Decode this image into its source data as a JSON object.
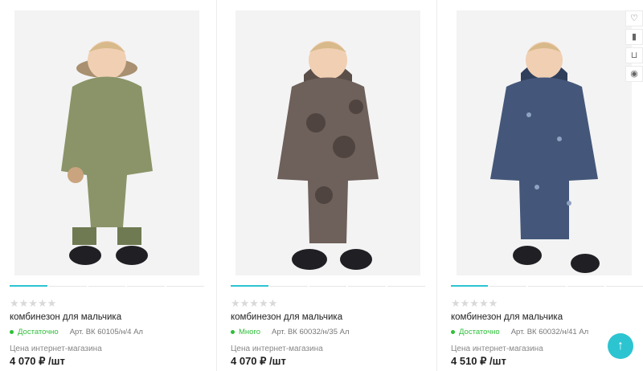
{
  "accent_color": "#2cc4d0",
  "stock_color": "#2fbf3a",
  "products": [
    {
      "stars": "★★★★★",
      "title": "комбинезон для мальчика",
      "stock": "Достаточно",
      "article": "Арт. ВК 60105/н/4 Ал",
      "price_label": "Цена интернет-магазина",
      "price": "4 070 ₽ /шт",
      "colors": [
        "#8a9468",
        "#6f7a52"
      ]
    },
    {
      "stars": "★★★★★",
      "title": "комбинезон для мальчика",
      "stock": "Много",
      "article": "Арт. ВК 60032/н/35 Ал",
      "price_label": "Цена интернет-магазина",
      "price": "4 070 ₽ /шт",
      "colors": [
        "#6e605a",
        "#4f443f"
      ]
    },
    {
      "stars": "★★★★★",
      "title": "комбинезон для мальчика",
      "stock": "Достаточно",
      "article": "Арт. ВК 60032/н/41 Ал",
      "price_label": "Цена интернет-магазина",
      "price": "4 510 ₽ /шт",
      "colors": [
        "#44577a",
        "#2f3f5c"
      ]
    }
  ],
  "action_icons": [
    "heart-icon",
    "compare-icon",
    "basket-icon",
    "eye-icon"
  ],
  "scroll_up": "↑"
}
